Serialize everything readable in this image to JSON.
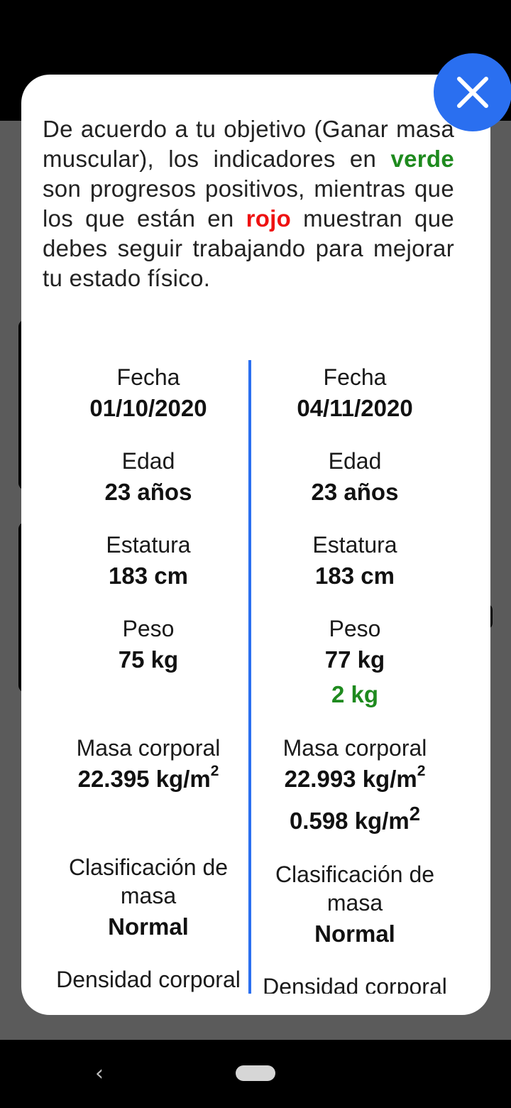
{
  "intro": {
    "part1": "De acuerdo a tu objetivo (Ganar masa muscular), los indicadores en ",
    "green_word": "verde",
    "part2": " son progresos positivos, mientras que los que están en ",
    "red_word": "rojo",
    "part3": " muestran que debes seguir trabajando para mejorar tu estado físico."
  },
  "colors": {
    "positive": "#1e8a1e",
    "negative": "#ee1111",
    "accent": "#2a6ff0"
  },
  "left": {
    "fecha_label": "Fecha",
    "fecha": "01/10/2020",
    "edad_label": "Edad",
    "edad": "23 años",
    "estatura_label": "Estatura",
    "estatura": "183 cm",
    "peso_label": "Peso",
    "peso": "75 kg",
    "masa_label": "Masa corporal",
    "masa": "22.395 kg/m",
    "masa_exp": "2",
    "clasif_label": "Clasificación de masa",
    "clasif": "Normal",
    "densidad_label": "Densidad corporal"
  },
  "right": {
    "fecha_label": "Fecha",
    "fecha": "04/11/2020",
    "edad_label": "Edad",
    "edad": "23 años",
    "estatura_label": "Estatura",
    "estatura": "183 cm",
    "peso_label": "Peso",
    "peso": "77 kg",
    "peso_delta": "2 kg",
    "masa_label": "Masa corporal",
    "masa": "22.993 kg/m",
    "masa_exp": "2",
    "masa_delta": "0.598 kg/m",
    "masa_delta_exp": "2",
    "clasif_label": "Clasificación de masa",
    "clasif": "Normal",
    "densidad_label": "Densidad corporal"
  },
  "icons": {
    "close": "close-icon",
    "back": "back-icon",
    "home": "home-pill"
  }
}
